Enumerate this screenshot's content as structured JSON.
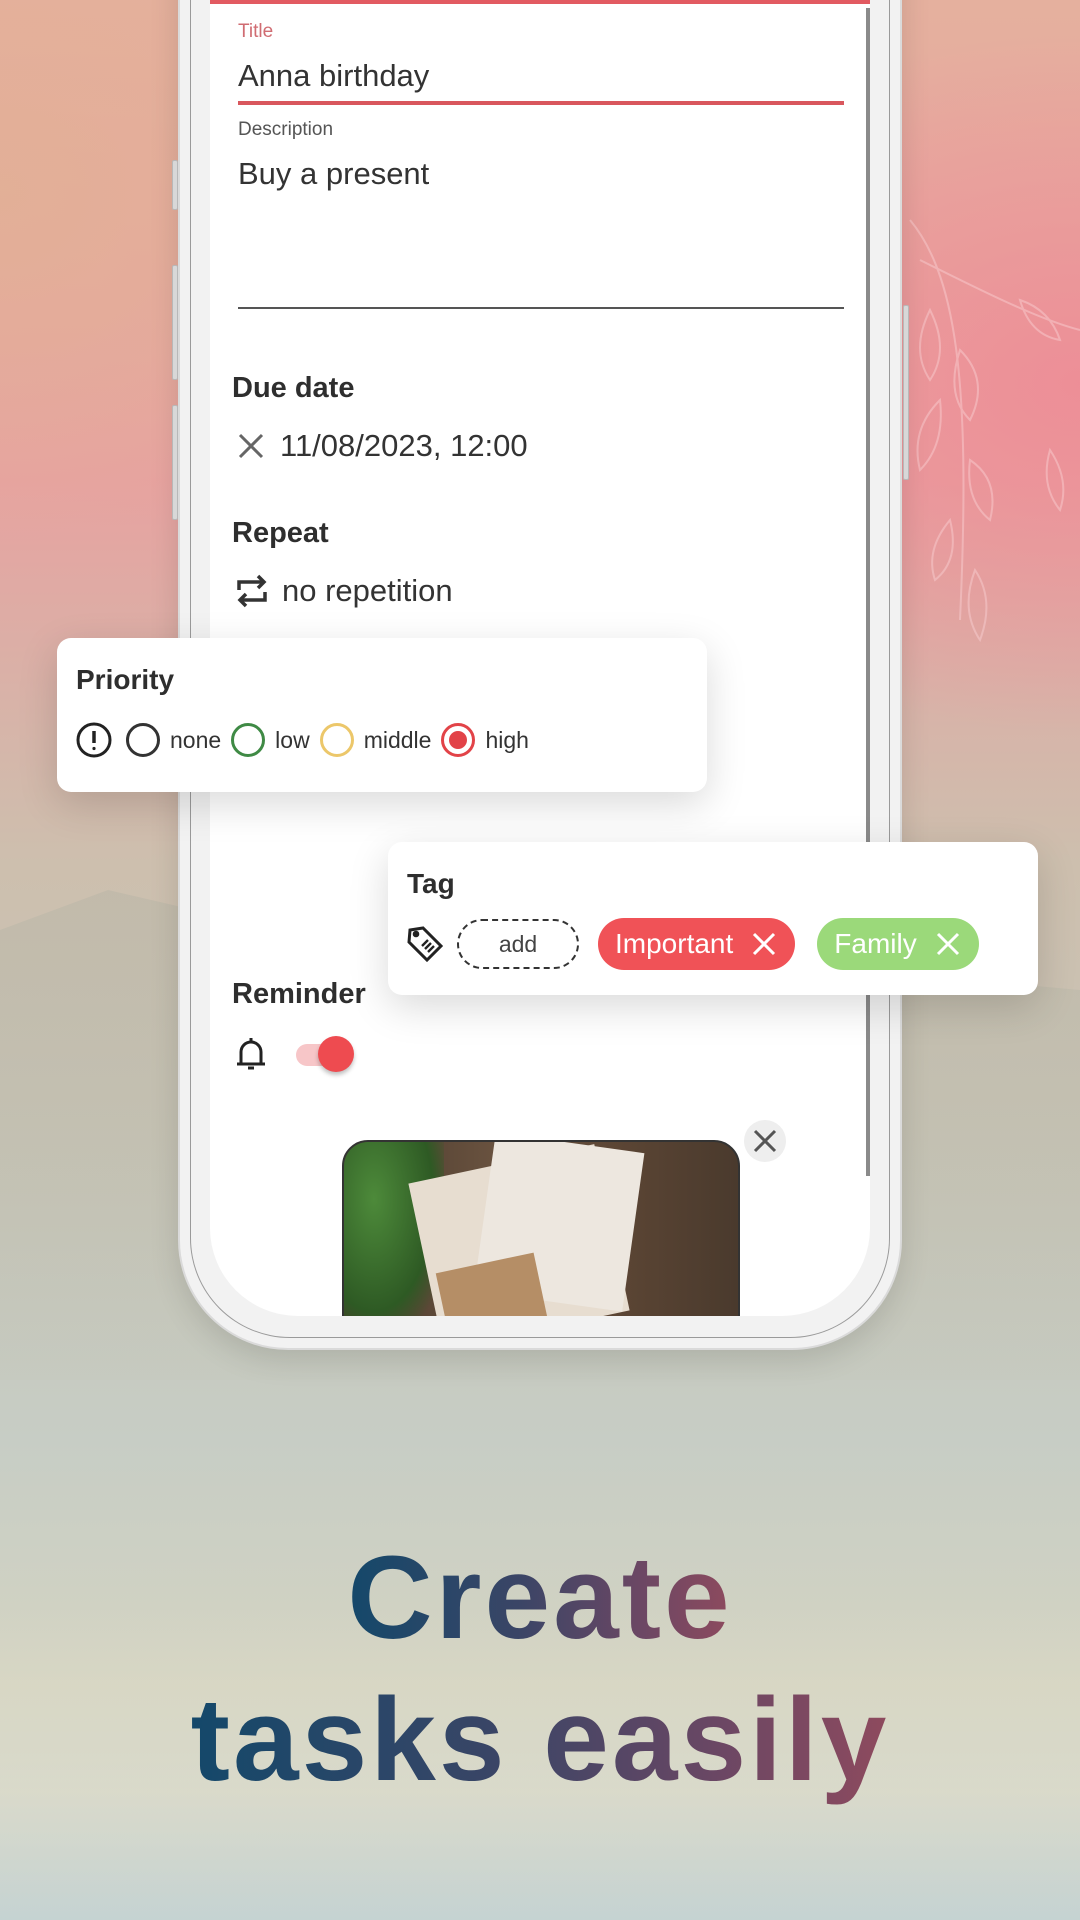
{
  "form": {
    "title_label": "Title",
    "title_value": "Anna birthday",
    "description_label": "Description",
    "description_value": "Buy a present",
    "due_date": {
      "heading": "Due date",
      "value": "11/08/2023, 12:00",
      "clear_icon": "close-icon"
    },
    "repeat": {
      "heading": "Repeat",
      "value": "no repetition",
      "icon": "repeat-icon"
    },
    "priority": {
      "heading": "Priority",
      "icon": "priority-alert-icon",
      "options": [
        {
          "label": "none",
          "color": "#333333",
          "selected": false
        },
        {
          "label": "low",
          "color": "#3f8a45",
          "selected": false
        },
        {
          "label": "middle",
          "color": "#ecc76a",
          "selected": false
        },
        {
          "label": "high",
          "color": "#e24348",
          "selected": true
        }
      ]
    },
    "tag": {
      "heading": "Tag",
      "icon": "tag-icon",
      "add_label": "add",
      "chips": [
        {
          "label": "Important",
          "color": "#f05257"
        },
        {
          "label": "Family",
          "color": "#9bd97a"
        }
      ]
    },
    "reminder": {
      "heading": "Reminder",
      "icon": "bell-icon",
      "enabled": true
    },
    "attachment": {
      "description": "gift packages photo",
      "remove_icon": "close-icon"
    }
  },
  "headline": {
    "line1": "Create",
    "line2": "tasks easily"
  },
  "colors": {
    "accent": "#e25a61",
    "important": "#f05257",
    "family": "#9bd97a"
  }
}
